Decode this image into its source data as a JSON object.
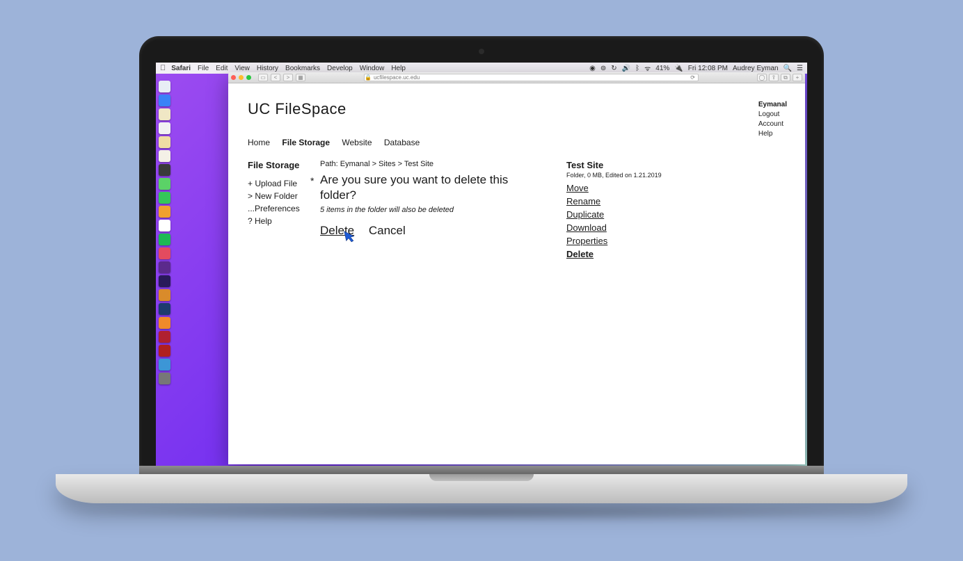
{
  "menubar": {
    "app": "Safari",
    "items": [
      "File",
      "Edit",
      "View",
      "History",
      "Bookmarks",
      "Develop",
      "Window",
      "Help"
    ],
    "battery": "41%",
    "time": "Fri 12:08 PM",
    "user": "Audrey Eyman"
  },
  "browser": {
    "url": "ucfilespace.uc.edu"
  },
  "dock_colors": [
    "#e8eef5",
    "#3a82f7",
    "#f0e7c5",
    "#f2f2f2",
    "#efdca4",
    "#f4f0e7",
    "#3a3a3a",
    "#5bd267",
    "#34c759",
    "#f0a030",
    "#ffffff",
    "#1db954",
    "#e34b5f",
    "#5b2a8c",
    "#2a1a5a",
    "#d98b2b",
    "#1d3b6e",
    "#f08a2a",
    "#b02030",
    "#b02020",
    "#3c96d6",
    "#777777"
  ],
  "page": {
    "title": "UC FileSpace",
    "user": {
      "name": "Eymanal",
      "links": [
        "Logout",
        "Account",
        "Help"
      ]
    },
    "nav": [
      "Home",
      "File Storage",
      "Website",
      "Database"
    ],
    "nav_active_index": 1,
    "sidebar": {
      "heading": "File Storage",
      "items": [
        {
          "prefix": "+ ",
          "label": "Upload File"
        },
        {
          "prefix": "> ",
          "label": "New Folder"
        },
        {
          "prefix": "...",
          "label": "Preferences"
        },
        {
          "prefix": "? ",
          "label": "Help"
        }
      ]
    },
    "breadcrumb": "Path: Eymanal > Sites > Test Site",
    "confirm": {
      "marker": "*",
      "question": "Are you sure you want to delete this folder?",
      "hint": "5 items in the folder will also be deleted",
      "primary": "Delete",
      "secondary": "Cancel"
    },
    "details": {
      "heading": "Test Site",
      "meta": "Folder, 0 MB, Edited on 1.21.2019",
      "actions": [
        "Move",
        "Rename",
        "Duplicate",
        "Download",
        "Properties",
        "Delete"
      ],
      "active_index": 5
    }
  }
}
